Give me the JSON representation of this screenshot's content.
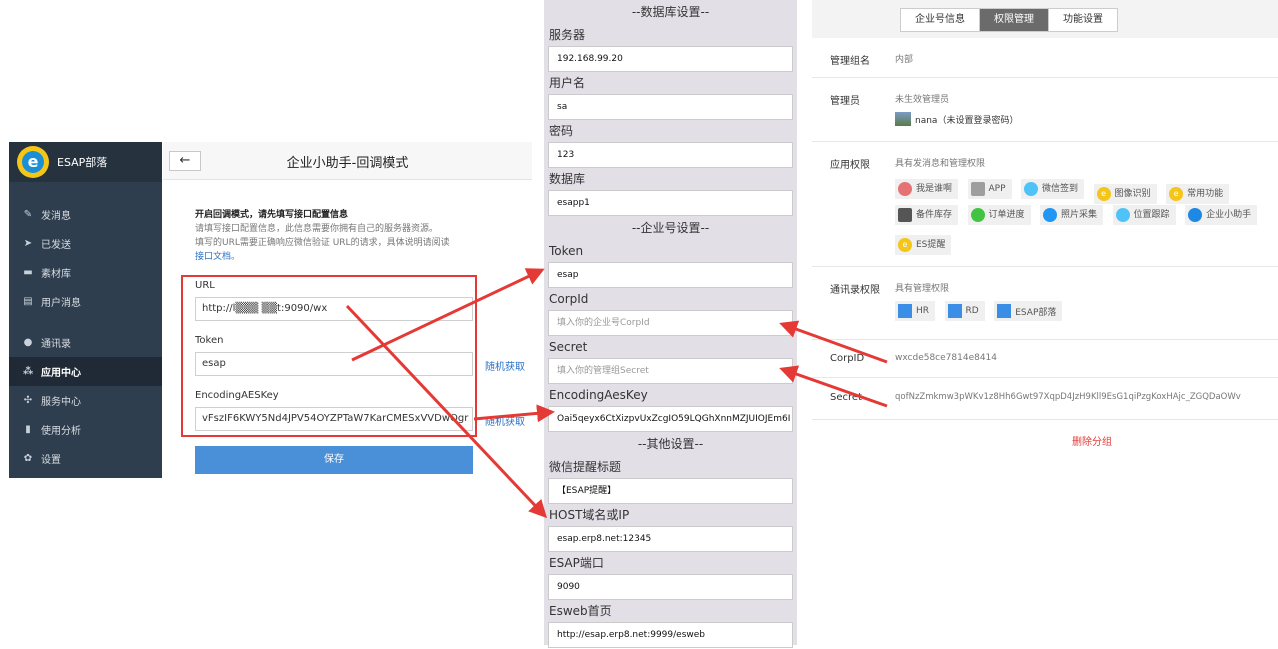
{
  "app": {
    "brand": "ESAP部落",
    "sidebar": [
      {
        "icon": "pencil-icon",
        "glyph": "✎",
        "label": "发消息"
      },
      {
        "icon": "send-icon",
        "glyph": "➤",
        "label": "已发送"
      },
      {
        "icon": "folder-icon",
        "glyph": "▬",
        "label": "素材库"
      },
      {
        "icon": "message-icon",
        "glyph": "▤",
        "label": "用户消息"
      },
      {
        "icon": "user-icon",
        "glyph": "●",
        "label": "通讯录"
      },
      {
        "icon": "app-center-icon",
        "glyph": "⁂",
        "label": "应用中心"
      },
      {
        "icon": "service-icon",
        "glyph": "✣",
        "label": "服务中心"
      },
      {
        "icon": "chart-icon",
        "glyph": "▮",
        "label": "使用分析"
      },
      {
        "icon": "gear-icon",
        "glyph": "✿",
        "label": "设置"
      }
    ],
    "back_glyph": "←",
    "title": "企业小助手-回调模式",
    "intro": {
      "heading": "开启回调模式，请先填写接口配置信息",
      "line1": "请填写接口配置信息，此信息需要你拥有自己的服务器资源。",
      "line2": "填写的URL需要正确响应微信验证 URL的请求，具体说明请阅读",
      "link": "接口文档",
      "tail": "。"
    },
    "fields": {
      "url_label": "URL",
      "url_value": "http://l▒▒▒ ▒▒t:9090/wx",
      "token_label": "Token",
      "token_value": "esap",
      "aes_label": "EncodingAESKey",
      "aes_value": "vFszIF6KWY5Nd4JPV54OYZPTaW7KarCMESxVVDwOgr"
    },
    "random_link": "随机获取",
    "random_link_2": "随机获取",
    "save": "保存"
  },
  "config": {
    "sec_db": "--数据库设置--",
    "server_label": "服务器",
    "server": "192.168.99.20",
    "user_label": "用户名",
    "user": "sa",
    "pwd_label": "密码",
    "pwd": "123",
    "db_label": "数据库",
    "db": "esapp1",
    "sec_corp": "--企业号设置--",
    "token_label": "Token",
    "token": "esap",
    "corpid_label": "CorpId",
    "corpid_placeholder": "填入你的企业号CorpId",
    "secret_label": "Secret",
    "secret_placeholder": "填入你的管理组Secret",
    "aes_label": "EncodingAesKey",
    "aes": "Oai5qeyx6CtXizpvUxZcgIO59LQGhXnnMZJUIOJEm6I",
    "sec_other": "--其他设置--",
    "wx_title_label": "微信提醒标题",
    "wx_title": "【ESAP提醒】",
    "host_label": "HOST域名或IP",
    "host": "esap.erp8.net:12345",
    "port_label": "ESAP端口",
    "port": "9090",
    "esweb_label": "Esweb首页",
    "esweb": "http://esap.erp8.net:9999/esweb"
  },
  "perm": {
    "tabs": [
      "企业号信息",
      "权限管理",
      "功能设置"
    ],
    "active_tab": 1,
    "group_label": "管理组名",
    "group_value": "内部",
    "admin_label": "管理员",
    "admin_status": "未生效管理员",
    "admin_name": "nana（未设置登录密码）",
    "app_label": "应用权限",
    "app_desc": "具有发消息和管理权限",
    "apps": [
      {
        "name": "我是谁啊",
        "icon": "people-icon",
        "color": "#e57373"
      },
      {
        "name": "APP",
        "icon": "app-icon",
        "color": "#9e9e9e"
      },
      {
        "name": "微信签到",
        "icon": "checkin-icon",
        "color": "#4fc3f7"
      },
      {
        "name": "图像识别",
        "icon": "image-recognition-icon",
        "color": "#f5c518"
      },
      {
        "name": "常用功能",
        "icon": "common-icon",
        "color": "#f5c518"
      },
      {
        "name": "备件库存",
        "icon": "inventory-icon",
        "color": "#555555"
      },
      {
        "name": "订单进度",
        "icon": "order-icon",
        "color": "#43c343"
      },
      {
        "name": "照片采集",
        "icon": "photo-icon",
        "color": "#2196f3"
      },
      {
        "name": "位置跟踪",
        "icon": "location-icon",
        "color": "#4fc3f7"
      },
      {
        "name": "企业小助手",
        "icon": "assistant-icon",
        "color": "#1e88e5"
      },
      {
        "name": "ES提醒",
        "icon": "es-reminder-icon",
        "color": "#f5c518"
      }
    ],
    "contact_label": "通讯录权限",
    "contact_desc": "具有管理权限",
    "depts": [
      "HR",
      "RD",
      "ESAP部落"
    ],
    "corpid_label": "CorpID",
    "corpid": "wxcde58ce7814e8414",
    "secret_label": "Secret",
    "secret": "qofNzZmkmw3pWKv1z8Hh6Gwt97XqpD4JzH9Kll9EsG1qiPzgKoxHAjc_ZGQDaOWv",
    "delete": "删除分组"
  },
  "colors": {
    "arrow": "#e53935",
    "sidebar": "#2f3e4e",
    "accent": "#4a90d9"
  }
}
